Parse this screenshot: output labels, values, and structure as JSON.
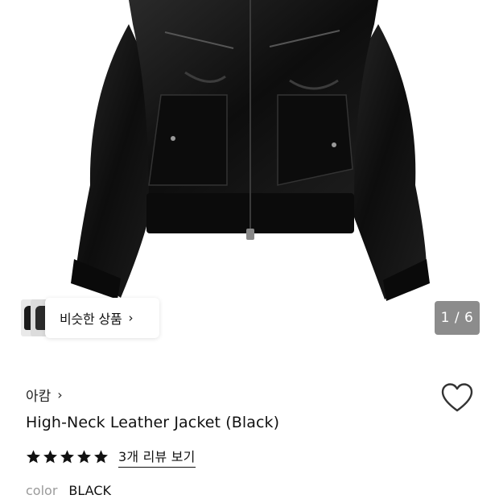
{
  "gallery": {
    "similar_label": "비슷한 상품",
    "similar_chevron": "›",
    "page_current": "1",
    "page_total": "6",
    "page_counter": "1 / 6"
  },
  "product": {
    "brand": "아캄",
    "brand_chevron": "›",
    "title": "High-Neck Leather Jacket (Black)",
    "rating_stars": 5,
    "review_link": "3개 리뷰 보기",
    "color_label": "color",
    "color_value": "BLACK"
  },
  "colors": {
    "text_primary": "#111111",
    "text_muted": "#9a9a9a",
    "counter_bg": "#8c8c8c",
    "jacket": "#111111"
  },
  "icons": {
    "wishlist": "heart-outline-icon",
    "star": "star-filled-icon",
    "chevron": "chevron-right-icon"
  }
}
